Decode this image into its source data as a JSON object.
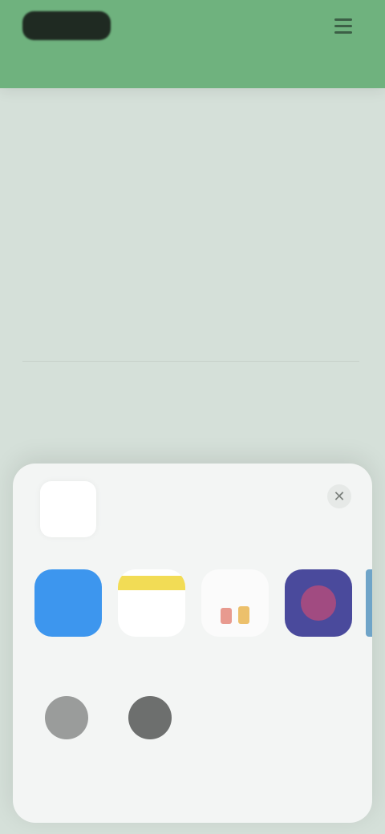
{
  "header": {
    "logo_text": "",
    "menu_icon": "hamburger-menu-icon",
    "color": "#6fb27e"
  },
  "content": {
    "lines": [
      "",
      "",
      "",
      "",
      ""
    ]
  },
  "share_sheet": {
    "title": "",
    "subtitle": "",
    "close_icon": "close-icon",
    "apps": [
      {
        "label": "",
        "icon": "blue-app-icon",
        "color": "#3d96ee"
      },
      {
        "label": "",
        "icon": "notes-app-icon",
        "color": "#f2dc55"
      },
      {
        "label": "",
        "icon": "reminders-app-icon",
        "color": "#fbfbfb"
      },
      {
        "label": "",
        "icon": "purple-app-icon",
        "color": "#4a4a9c"
      }
    ],
    "actions": [
      {
        "label": "",
        "icon": "action-icon-1"
      },
      {
        "label": "",
        "icon": "action-icon-2"
      }
    ]
  }
}
